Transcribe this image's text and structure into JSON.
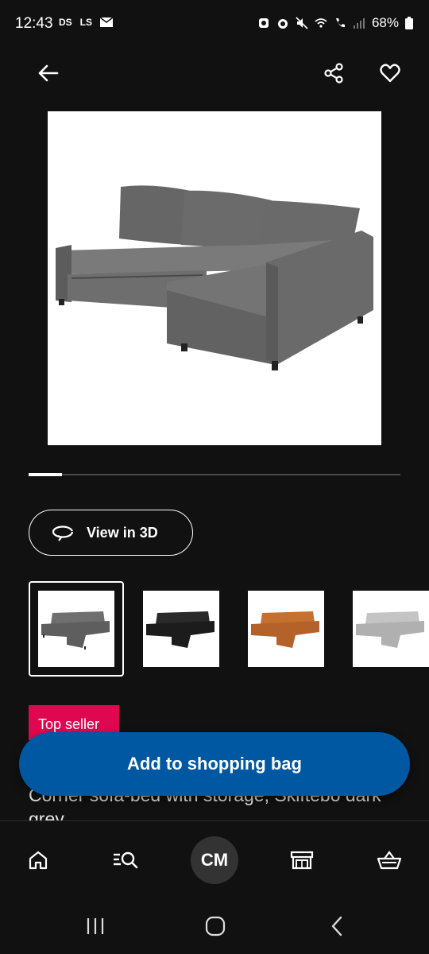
{
  "status_bar": {
    "time": "12:43",
    "left_icons": [
      "DS",
      "LS",
      "mail-icon"
    ],
    "battery": "68%"
  },
  "top_bar": {
    "back_icon": "arrow-left-icon",
    "share_icon": "share-icon",
    "favorite_icon": "heart-icon"
  },
  "product": {
    "image_icon": "corner-sofa-bed-grey",
    "view_3d_label": "View in 3D",
    "badge": "Top seller",
    "name": "Corner sofa-bed with storage, Skiftebo dark grey",
    "variants": [
      {
        "color_name": "dark grey",
        "color": "#6f6f6f",
        "selected": true
      },
      {
        "color_name": "black",
        "color": "#2a2a2a",
        "selected": false
      },
      {
        "color_name": "orange",
        "color": "#c5702e",
        "selected": false
      },
      {
        "color_name": "light grey",
        "color": "#bcbcbc",
        "selected": false
      }
    ],
    "carousel_progress": 0.09
  },
  "cta": {
    "add_to_bag_label": "Add to shopping bag"
  },
  "bottom_nav": {
    "items": [
      "home-icon",
      "search-icon",
      "account-avatar",
      "store-icon",
      "basket-icon"
    ],
    "avatar_initials": "CM"
  },
  "system_nav": [
    "recents-icon",
    "home-circle-icon",
    "back-chevron-icon"
  ],
  "colors": {
    "background": "#111111",
    "primary_blue": "#0058a3",
    "badge_red": "#e00751"
  }
}
